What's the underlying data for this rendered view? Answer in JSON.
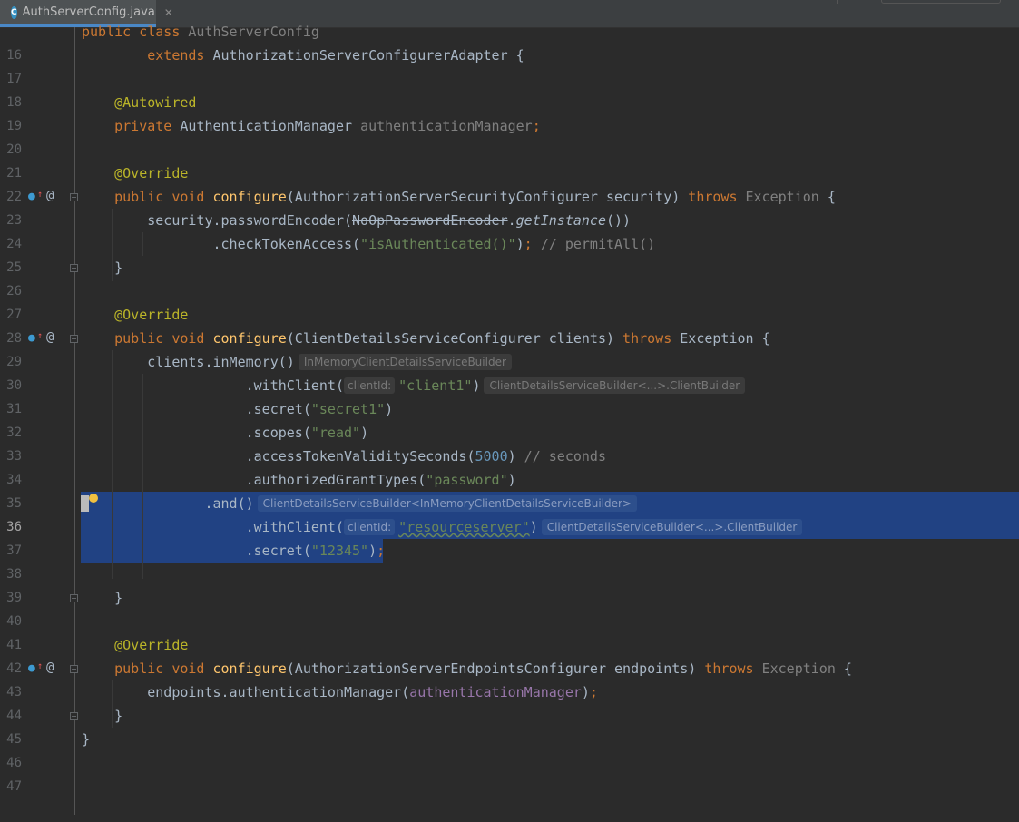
{
  "tab": {
    "filename": "AuthServerConfig.java",
    "icon": "class-icon",
    "close": "✕"
  },
  "lines": [
    {
      "n": "16",
      "code": "public class AuthServerConfig"
    },
    {
      "n": "17",
      "code": "extends AuthorizationServerConfigurerAdapter {"
    },
    {
      "n": "18",
      "code": ""
    },
    {
      "n": "19",
      "code": "@Autowired"
    },
    {
      "n": "20",
      "code": "private AuthenticationManager authenticationManager;"
    },
    {
      "n": "21",
      "code": ""
    },
    {
      "n": "22",
      "code": "@Override"
    },
    {
      "n": "23",
      "code": "public void configure(AuthorizationServerSecurityConfigurer security) throws Exception {"
    },
    {
      "n": "24",
      "code": "security.passwordEncoder(NoOpPasswordEncoder.getInstance())"
    },
    {
      "n": "25",
      "code": ".checkTokenAccess(\"isAuthenticated()\"); // permitAll()"
    },
    {
      "n": "26",
      "code": "}"
    },
    {
      "n": "27",
      "code": ""
    },
    {
      "n": "28",
      "code": "@Override"
    },
    {
      "n": "29",
      "code": "public void configure(ClientDetailsServiceConfigurer clients) throws Exception {"
    },
    {
      "n": "30",
      "code": "clients.inMemory()"
    },
    {
      "n": "31",
      "code": ".withClient(\"client1\")"
    },
    {
      "n": "32",
      "code": ".secret(\"secret1\")"
    },
    {
      "n": "33",
      "code": ".scopes(\"read\")"
    },
    {
      "n": "34",
      "code": ".accessTokenValiditySeconds(5000) // seconds"
    },
    {
      "n": "35",
      "code": ".authorizedGrantTypes(\"password\")"
    },
    {
      "n": "36",
      "code": ".and()"
    },
    {
      "n": "37",
      "code": ".withClient(\"resourceserver\")"
    },
    {
      "n": "38",
      "code": ".secret(\"12345\");"
    },
    {
      "n": "39",
      "code": ""
    },
    {
      "n": "40",
      "code": "}"
    },
    {
      "n": "41",
      "code": ""
    },
    {
      "n": "42",
      "code": "@Override"
    },
    {
      "n": "43",
      "code": "public void configure(AuthorizationServerEndpointsConfigurer endpoints) throws Exception {"
    },
    {
      "n": "44",
      "code": "endpoints.authenticationManager(authenticationManager);"
    },
    {
      "n": "45",
      "code": "}"
    },
    {
      "n": "46",
      "code": "}"
    },
    {
      "n": "47",
      "code": ""
    }
  ],
  "hints": {
    "inMemory": "InMemoryClientDetailsServiceBuilder",
    "withClient": "ClientDetailsServiceBuilder<...>.ClientBuilder",
    "and": "ClientDetailsServiceBuilder<InMemoryClientDetailsServiceBuilder>",
    "param": "clientId:"
  },
  "colors": {
    "background": "#2b2b2b",
    "keyword": "#cc7832",
    "annotation": "#bbb529",
    "method": "#ffc66d",
    "string": "#6a8759",
    "number": "#6897bb",
    "comment": "#808080",
    "field": "#9876aa",
    "selection": "#214283"
  }
}
